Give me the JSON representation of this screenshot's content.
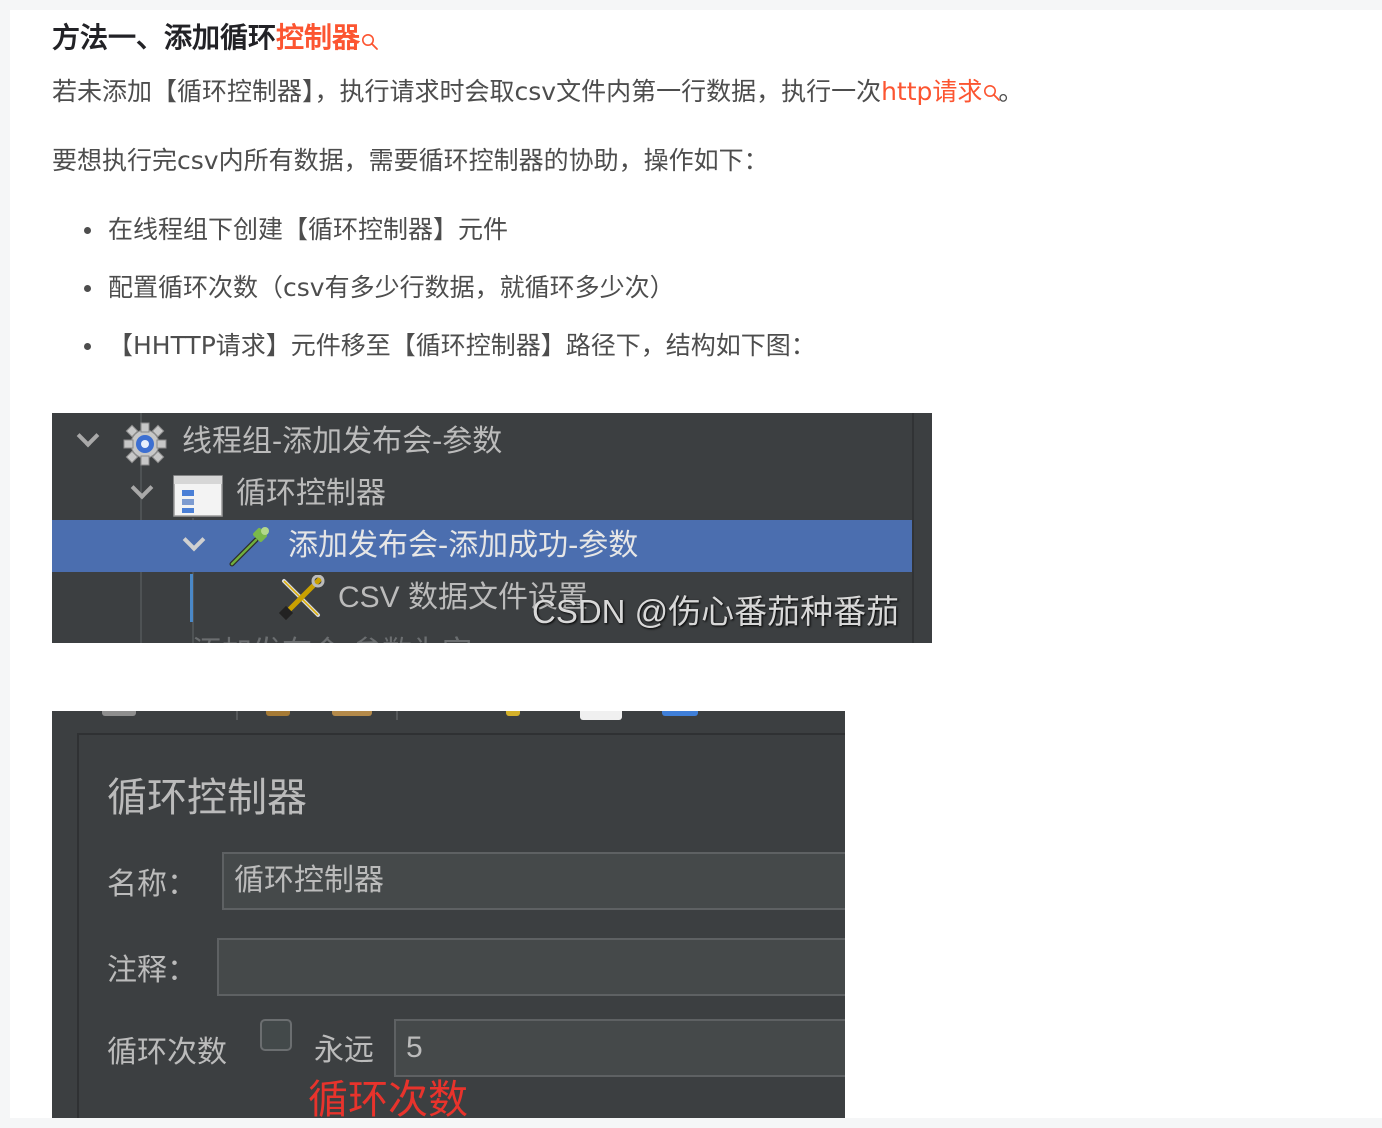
{
  "article": {
    "heading": {
      "prefix": "方法一、添加循环",
      "keyword": "控制器"
    },
    "para1": {
      "text_before": "若未添加【循环控制器】，执行请求时会取csv文件内第一行数据，执行一次",
      "keyword": "http请求",
      "text_after": "。"
    },
    "para2": "要想执行完csv内所有数据，需要循环控制器的协助，操作如下：",
    "bullets": [
      "在线程组下创建【循环控制器】元件",
      "配置循环次数（csv有多少行数据，就循环多少次）",
      "【HHTTP请求】元件移至【循环控制器】路径下，结构如下图："
    ],
    "colors": {
      "keyword": "#fc5531",
      "text": "#4d4d4d",
      "heading": "#222226"
    }
  },
  "tree_screenshot": {
    "rows": [
      {
        "label": "线程组-添加发布会-参数",
        "icon": "thread-group-gear-icon",
        "expanded": true
      },
      {
        "label": "循环控制器",
        "icon": "loop-controller-icon",
        "expanded": true
      },
      {
        "label": "添加发布会-添加成功-参数",
        "icon": "http-sampler-pipette-icon",
        "expanded": true,
        "selected": true
      },
      {
        "label": "CSV 数据文件设置",
        "icon": "csv-config-tools-icon"
      }
    ],
    "ghost_row": "添加发布会-参数为空",
    "watermark": "CSDN @伤心番茄种番茄",
    "colors": {
      "background": "#3c3f41",
      "selected": "#4b6eaf"
    }
  },
  "loop_controller_screenshot": {
    "title": "循环控制器",
    "name_label": "名称：",
    "name_value": "循环控制器",
    "comment_label": "注释：",
    "comment_value": "",
    "loop_count_label": "循环次数",
    "forever_label": "永远",
    "forever_checked": false,
    "loop_count_value": "5",
    "annotation": "循环次数",
    "colors": {
      "annotation": "#e8332c"
    }
  }
}
